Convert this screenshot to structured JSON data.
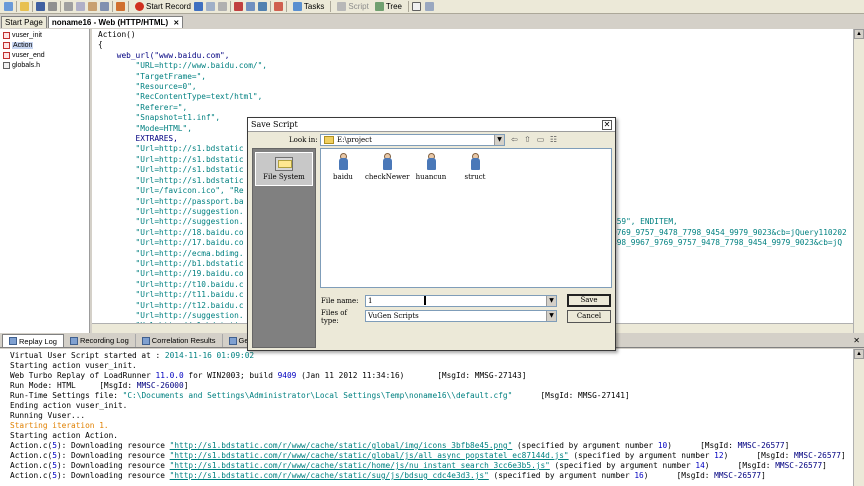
{
  "toolbar": {
    "start_record": "Start Record",
    "tasks": "Tasks",
    "script": "Script",
    "tree": "Tree"
  },
  "doc_tabs": [
    {
      "label": "Start Page"
    },
    {
      "label": "noname16 - Web (HTTP/HTML)"
    }
  ],
  "tree_items": [
    {
      "label": "vuser_init"
    },
    {
      "label": "Action"
    },
    {
      "label": "vuser_end"
    },
    {
      "label": "globals.h"
    }
  ],
  "code": {
    "lines": [
      "Action()",
      "{",
      "",
      "",
      "    web_url(\"www.baidu.com\",",
      "        \"URL=http://www.baidu.com/\",",
      "        \"TargetFrame=\",",
      "        \"Resource=0\",",
      "        \"RecContentType=text/html\",",
      "        \"Referer=\",",
      "        \"Snapshot=t1.inf\",",
      "        \"Mode=HTML\",",
      "        EXTRARES,",
      "        \"Url=http://s1.bdstatic",
      "        \"Url=http://s1.bdstatic",
      "        \"Url=http://s1.bdstatic",
      "        \"Url=http://s1.bdstatic",
      "        \"Url=/favicon.ico\", \"Re",
      "        \"Url=http://passport.ba",
      "        \"Url=http://suggestion.",
      "        \"Url=http://suggestion.",
      "        \"Url=http://18.baidu.co",
      "        \"Url=http://17.baidu.co",
      "        \"Url=http://ecma.bdimg.",
      "        \"Url=http://b1.bdstatic",
      "        \"Url=http://19.baidu.co",
      "        \"Url=http://t10.baidu.c",
      "        \"Url=http://t11.baidu.c",
      "        \"Url=http://t12.baidu.c",
      "        \"Url=http://suggestion.",
      "        \"Url=http://s1.bdstatic",
      "        \"Url=http://s1.bdstatic",
      "        \"Url=http://suggestion."
    ],
    "right_fragments": [
      {
        "line": 18,
        "text": "359\", ENDITEM,"
      },
      {
        "line": 19,
        "text": "9769_9757_9478_7798_9454_9979_9023&cb=jQuery110202"
      },
      {
        "line": 20,
        "text": "498_9967_9769_9757_9478_7798_9454_9979_9023&cb=jQ"
      },
      {
        "line": 29,
        "text": "9769_9757_9478_7798_9454_9979_9023&cb=jQuery110202"
      },
      {
        "line": 31,
        "text": "7_9478_7798_9454_9979_9023&cb=jQuery11020241778"
      },
      {
        "line": 32,
        "text": "9769_9757_9478_7798_9454_9979_9023&cb=jQuery110202"
      }
    ]
  },
  "panel_tabs": [
    {
      "label": "Replay Log"
    },
    {
      "label": "Recording Log"
    },
    {
      "label": "Correlation Results"
    },
    {
      "label": "Genera"
    }
  ],
  "log": {
    "l1a": "Virtual User Script started at : ",
    "l1b": "2014-11-16 01:09:02",
    "l2": "Starting action vuser_init.",
    "l3a": "Web Turbo Replay of LoadRunner ",
    "l3b": "11.0.0",
    "l3c": " for WIN2003; build ",
    "l3d": "9409",
    "l3e": " (Jan 11 2012 11:34:16)",
    "l3f": "       [MsgId: MMSG-27143]",
    "l4a": "Run Mode: HTML     [MsgId: ",
    "l4b": "MMSC-26000",
    "l4c": "]",
    "l5a": "Run-Time Settings file: ",
    "l5b": "\"C:\\Documents and Settings\\Administrator\\Local Settings\\Temp\\noname16\\\\default.cfg\"",
    "l5c": "      [MsgId: MMSG-27141]",
    "l6": "Ending action vuser_init.",
    "l7": "Running Vuser...",
    "l8": "Starting iteration 1.",
    "l9": "Starting action Action.",
    "downloads": [
      {
        "num": "5",
        "url": "\"http://s1.bdstatic.com/r/www/cache/static/global/img/icons_3bfb8e45.png\"",
        "arg": "10",
        "msg": "MMSC-26577"
      },
      {
        "num": "5",
        "url": "\"http://s1.bdstatic.com/r/www/cache/static/global/js/all_async_popstatel_ec87144d.js\"",
        "arg": "12",
        "msg": "MMSC-26577"
      },
      {
        "num": "5",
        "url": "\"http://s1.bdstatic.com/r/www/cache/static/home/js/nu_instant_search_3cc6e3b5.js\"",
        "arg": "14",
        "msg": "MMSC-26577"
      },
      {
        "num": "5",
        "url": "\"http://s1.bdstatic.com/r/www/cache/static/sug/js/bdsug_cdc4e3d3.js\"",
        "arg": "16",
        "msg": "MMSC-26577"
      }
    ],
    "dl_prefix": "Action.c(",
    "dl_mid": "): Downloading resource ",
    "dl_spec": " (specified by argument number ",
    "dl_msg": ")      [MsgId: "
  },
  "dialog": {
    "title": "Save Script",
    "look_in_label": "Look in:",
    "look_in_value": "E:\\project",
    "places": [
      {
        "label": "File System"
      }
    ],
    "files": [
      {
        "label": "baidu"
      },
      {
        "label": "checkNewer"
      },
      {
        "label": "huancun"
      },
      {
        "label": "struct"
      }
    ],
    "file_name_label": "File name:",
    "file_name_value": "1",
    "file_type_label": "Files of type:",
    "file_type_value": "VuGen Scripts",
    "save_label": "Save",
    "cancel_label": "Cancel"
  }
}
